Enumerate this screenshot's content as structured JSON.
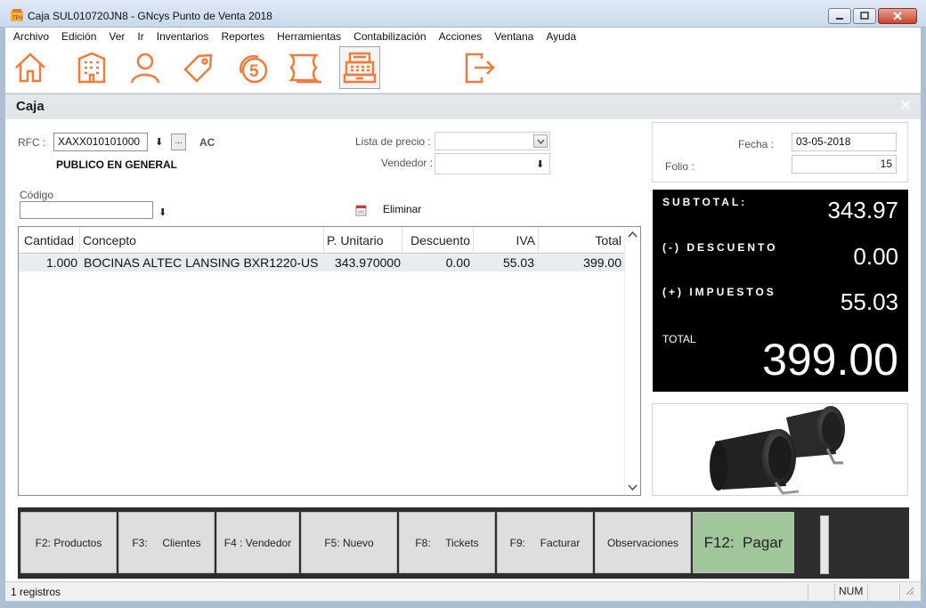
{
  "window": {
    "title": "Caja SUL010720JN8 - GNcys Punto de Venta 2018"
  },
  "menu": [
    "Archivo",
    "Edición",
    "Ver",
    "Ir",
    "Inventarios",
    "Reportes",
    "Herramientas",
    "Contabilización",
    "Acciones",
    "Ventana",
    "Ayuda"
  ],
  "toolbar": {
    "accent_color": "#f07b3a",
    "icons": [
      "home-icon",
      "building-icon",
      "user-icon",
      "tag-icon",
      "coin-icon",
      "ticket-icon",
      "cash-register-icon",
      "exit-icon"
    ]
  },
  "panel": {
    "title": "Caja",
    "close": "✕"
  },
  "customer": {
    "rfc_label": "RFC :",
    "rfc_value": "XAXX010101000",
    "more_button": "...",
    "status": "AC",
    "name": "PUBLICO EN GENERAL"
  },
  "pricing": {
    "price_list_label": "Lista de precio :",
    "price_list_value": "",
    "seller_label": "Vendedor :",
    "seller_value": ""
  },
  "code": {
    "label": "Código",
    "value": ""
  },
  "delete_label": "Eliminar",
  "grid": {
    "columns": [
      "Cantidad",
      "Concepto",
      "P. Unitario",
      "Descuento",
      "IVA",
      "Total"
    ],
    "rows": [
      [
        "1.000",
        "BOCINAS ALTEC LANSING BXR1220-US",
        "343.970000",
        "0.00",
        "55.03",
        "399.00"
      ]
    ]
  },
  "invoice": {
    "date_label": "Fecha :",
    "date_value": "03-05-2018",
    "folio_label": "Folio :",
    "folio_value": "15"
  },
  "totals": {
    "subtotal_label": "SUBTOTAL:",
    "subtotal_value": "343.97",
    "discount_label": "(-) DESCUENTO",
    "discount_value": "0.00",
    "tax_label": "(+) IMPUESTOS",
    "tax_value": "55.03",
    "total_label": "TOTAL",
    "total_value": "399.00"
  },
  "fkeys": {
    "products": "F2: Productos",
    "clients": "F3:     Clientes",
    "seller": "F4 : Vendedor",
    "new": "F5: Nuevo",
    "tickets": "F8:     Tickets",
    "invoice": "F9:     Facturar",
    "notes": "Observaciones",
    "pay": "F12:  Pagar",
    "pay_color": "#a1c69c"
  },
  "status": {
    "records": "1 registros",
    "num": "NUM"
  }
}
